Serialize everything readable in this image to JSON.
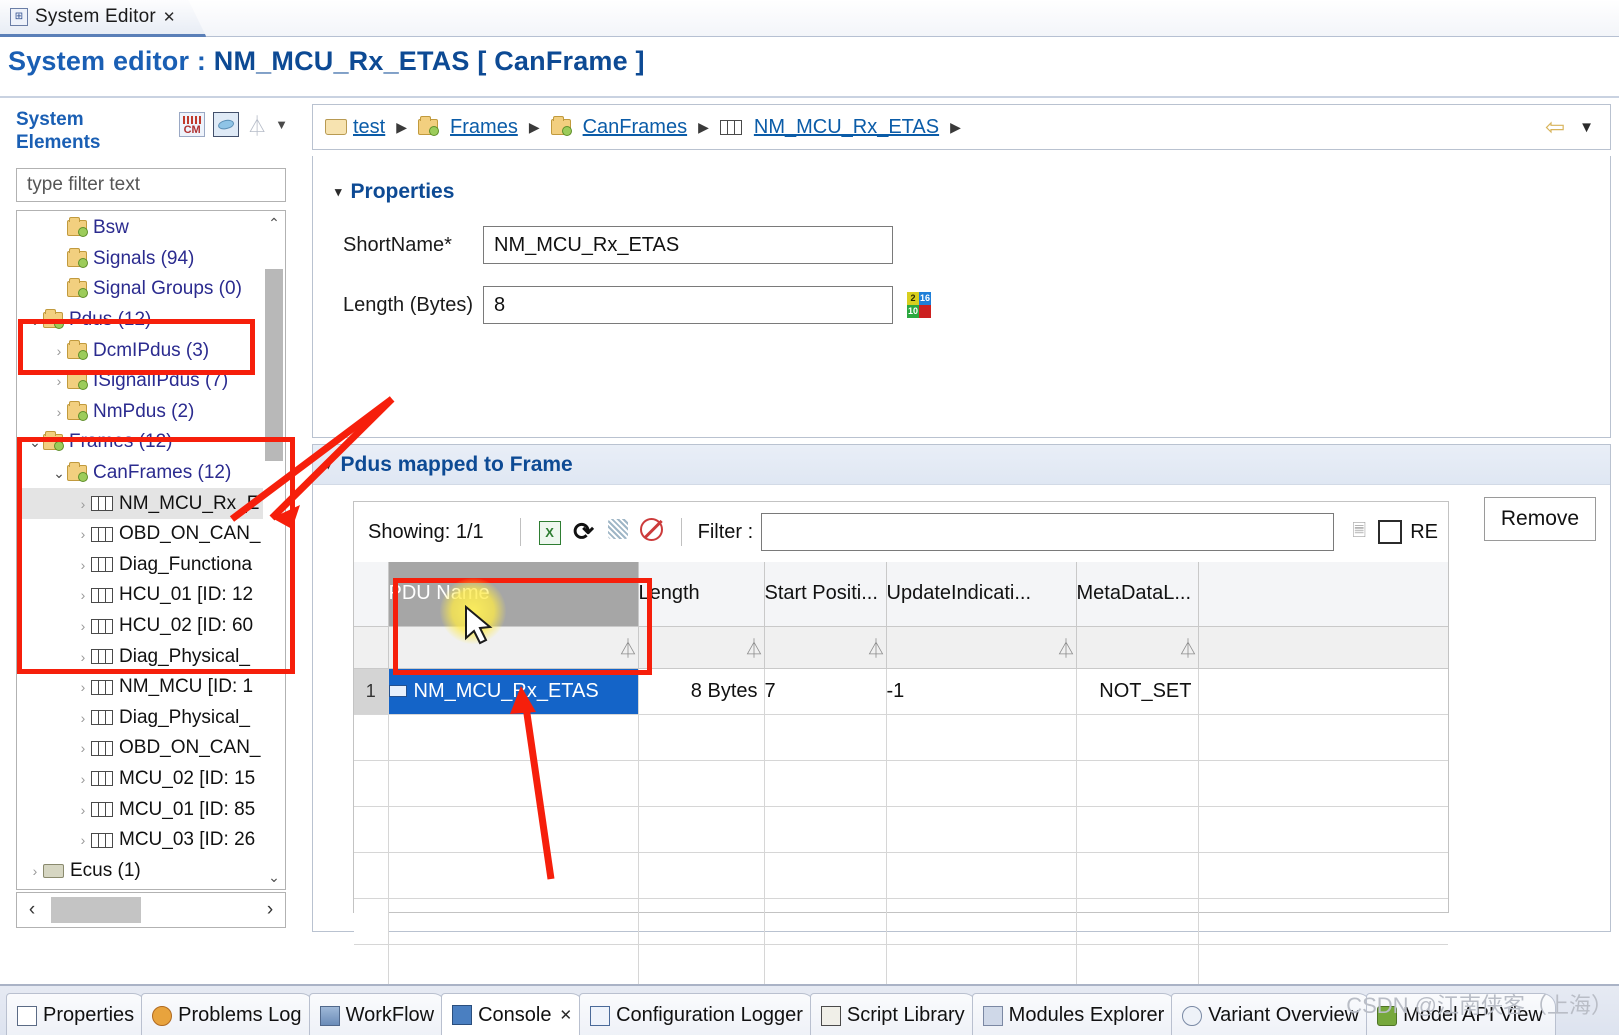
{
  "window": {
    "editor_tab": {
      "label": "System Editor",
      "close": "✕",
      "icon": "system-editor-icon"
    },
    "editor_title_prefix": "System editor : ",
    "editor_title_name": "NM_MCU_Rx_ETAS [ CanFrame ]"
  },
  "left_panel": {
    "title": "System\nElements",
    "title_line1": "System",
    "title_line2": "Elements",
    "icons": [
      "cm-icon",
      "diagram-icon",
      "filter-funnel-icon",
      "view-menu-caret-icon"
    ],
    "filter_placeholder": "type filter text",
    "filter_value": "",
    "tree": [
      {
        "label": "Bsw",
        "icon": "folder-icon",
        "indent": 1,
        "twisty": "",
        "kind": "folder"
      },
      {
        "label": "Signals (94)",
        "icon": "folder-icon",
        "indent": 1,
        "twisty": "",
        "kind": "folder"
      },
      {
        "label": "Signal Groups (0)",
        "icon": "folder-icon",
        "indent": 1,
        "twisty": "",
        "kind": "folder"
      },
      {
        "label": "Pdus (12)",
        "icon": "folder-icon",
        "indent": 0,
        "twisty": "⌄",
        "kind": "folder"
      },
      {
        "label": "DcmIPdus (3)",
        "icon": "folder-icon",
        "indent": 1,
        "twisty": "›",
        "kind": "folder"
      },
      {
        "label": "ISignalIPdus (7)",
        "icon": "folder-icon",
        "indent": 1,
        "twisty": "›",
        "kind": "folder"
      },
      {
        "label": "NmPdus (2)",
        "icon": "folder-icon",
        "indent": 1,
        "twisty": "›",
        "kind": "folder"
      },
      {
        "label": "Frames (12)",
        "icon": "folder-icon",
        "indent": 0,
        "twisty": "⌄",
        "kind": "folder"
      },
      {
        "label": "CanFrames (12)",
        "icon": "folder-icon",
        "indent": 1,
        "twisty": "⌄",
        "kind": "folder"
      },
      {
        "label": "NM_MCU_Rx_E",
        "icon": "frame-icon",
        "indent": 2,
        "twisty": "›",
        "kind": "frame",
        "selected": true
      },
      {
        "label": "OBD_ON_CAN_",
        "icon": "frame-icon",
        "indent": 2,
        "twisty": "›",
        "kind": "frame"
      },
      {
        "label": "Diag_Functiona",
        "icon": "frame-icon",
        "indent": 2,
        "twisty": "›",
        "kind": "frame"
      },
      {
        "label": "HCU_01 [ID: 12",
        "icon": "frame-icon",
        "indent": 2,
        "twisty": "›",
        "kind": "frame"
      },
      {
        "label": "HCU_02 [ID: 60",
        "icon": "frame-icon",
        "indent": 2,
        "twisty": "›",
        "kind": "frame"
      },
      {
        "label": "Diag_Physical_",
        "icon": "frame-icon",
        "indent": 2,
        "twisty": "›",
        "kind": "frame"
      },
      {
        "label": "NM_MCU [ID: 1",
        "icon": "frame-icon",
        "indent": 2,
        "twisty": "›",
        "kind": "frame"
      },
      {
        "label": "Diag_Physical_",
        "icon": "frame-icon",
        "indent": 2,
        "twisty": "›",
        "kind": "frame"
      },
      {
        "label": "OBD_ON_CAN_",
        "icon": "frame-icon",
        "indent": 2,
        "twisty": "›",
        "kind": "frame"
      },
      {
        "label": "MCU_02 [ID: 15",
        "icon": "frame-icon",
        "indent": 2,
        "twisty": "›",
        "kind": "frame"
      },
      {
        "label": "MCU_01 [ID: 85",
        "icon": "frame-icon",
        "indent": 2,
        "twisty": "›",
        "kind": "frame"
      },
      {
        "label": "MCU_03 [ID: 26",
        "icon": "frame-icon",
        "indent": 2,
        "twisty": "›",
        "kind": "frame"
      },
      {
        "label": "Ecus (1)",
        "icon": "ecu-icon",
        "indent": 0,
        "twisty": "›",
        "kind": "ecu"
      }
    ],
    "vscroll": {
      "up": "⌃",
      "down": "⌄"
    },
    "hscroll": {
      "left": "‹",
      "right": "›"
    }
  },
  "breadcrumb": {
    "items": [
      {
        "label": "test",
        "icon": "folder-open-icon"
      },
      {
        "label": "Frames",
        "icon": "folder-icon"
      },
      {
        "label": "CanFrames",
        "icon": "folder-icon"
      },
      {
        "label": "NM_MCU_Rx_ETAS",
        "icon": "frame-icon"
      }
    ],
    "separator": "▶",
    "back_icon": "back-arrow-icon",
    "menu_caret": "▼"
  },
  "properties": {
    "section_title": "Properties",
    "twisty": "▾",
    "fields": [
      {
        "label": "ShortName*",
        "value": "NM_MCU_Rx_ETAS"
      },
      {
        "label": "Length (Bytes)",
        "value": "8",
        "trailing_icon": "radix-2-16-icon"
      }
    ]
  },
  "pdus_section": {
    "title": "Pdus mapped to Frame",
    "twisty": "▾",
    "remove_label": "Remove",
    "toolbar": {
      "showing_label": "Showing: 1/1",
      "icons": [
        "export-excel-icon",
        "refresh-icon",
        "hide-columns-icon",
        "clear-filters-icon"
      ],
      "filter_label": "Filter :",
      "filter_value": "",
      "clear_icon": "clear-filter-icon",
      "re_checked": false,
      "re_label": "RE"
    },
    "table": {
      "columns": [
        "PDU Name",
        "Length",
        "Start Positi...",
        "UpdateIndicati...",
        "MetaDataL..."
      ],
      "active_column": "PDU Name",
      "filter_row_icon": "funnel-icon",
      "rows": [
        {
          "num": "1",
          "selected": true,
          "pdu_name": "NM_MCU_Rx_ETAS",
          "length": "8 Bytes",
          "start_position": "7",
          "update_indication": "-1",
          "metadata_length": "NOT_SET"
        }
      ],
      "empty_row_count": 7
    }
  },
  "bottom_tabs": [
    {
      "label": "Properties",
      "icon": "properties-icon",
      "active": false,
      "close": ""
    },
    {
      "label": "Problems Log",
      "icon": "problems-log-icon",
      "active": false,
      "close": ""
    },
    {
      "label": "WorkFlow",
      "icon": "workflow-icon",
      "active": false,
      "close": ""
    },
    {
      "label": "Console",
      "icon": "console-icon",
      "active": true,
      "close": "✕"
    },
    {
      "label": "Configuration Logger",
      "icon": "configuration-logger-icon",
      "active": false,
      "close": ""
    },
    {
      "label": "Script Library",
      "icon": "script-library-icon",
      "active": false,
      "close": ""
    },
    {
      "label": "Modules Explorer",
      "icon": "modules-explorer-icon",
      "active": false,
      "close": ""
    },
    {
      "label": "Variant Overview",
      "icon": "variant-overview-icon",
      "active": false,
      "close": ""
    },
    {
      "label": "Model API View",
      "icon": "model-api-view-icon",
      "active": false,
      "close": ""
    }
  ],
  "watermark": "CSDN @江南侠客（上海）",
  "colors": {
    "accent_blue": "#0d4a94",
    "link_blue": "#0b5ca8",
    "selection_blue": "#1464c8",
    "annotation_red": "#f61f0b",
    "highlight_yellow": "#ffeb46"
  }
}
